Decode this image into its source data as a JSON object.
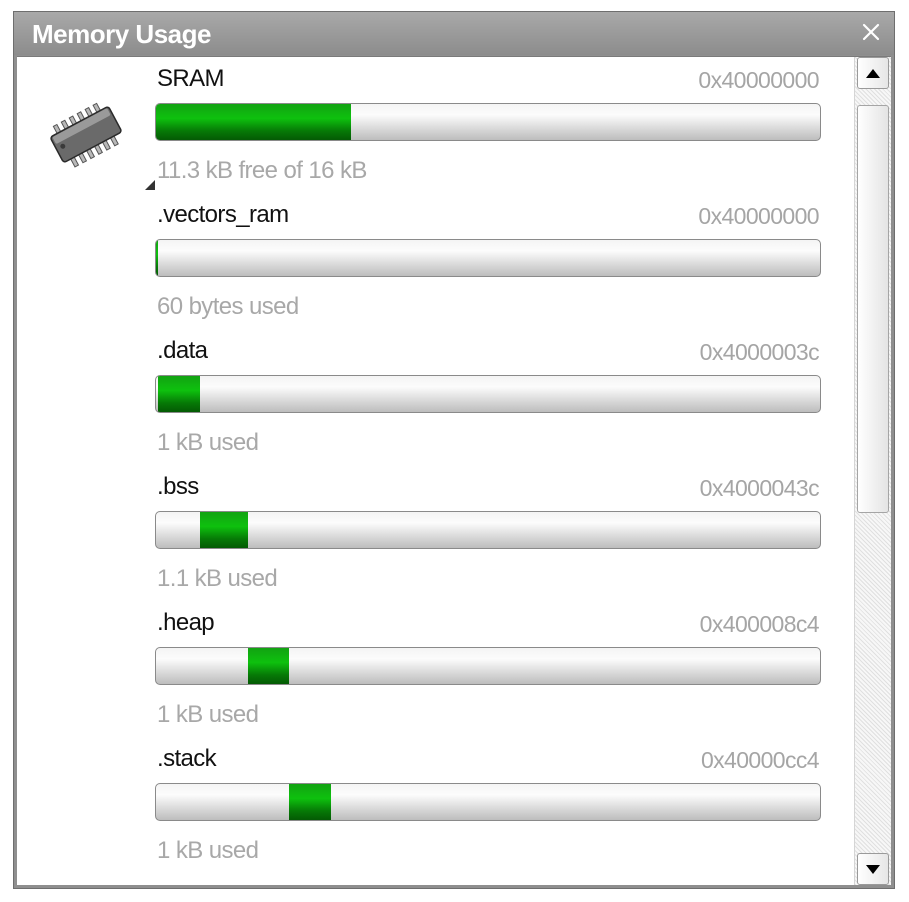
{
  "window": {
    "title": "Memory Usage",
    "close_label": "✕"
  },
  "memory": {
    "name": "SRAM",
    "address": "0x40000000",
    "summary": "11.3 kB free of 16 kB",
    "used_fraction": 0.294
  },
  "sections": [
    {
      "name": ".vectors_ram",
      "address": "0x40000000",
      "desc": "60 bytes used",
      "start_fraction": 0.0,
      "end_fraction": 0.0037
    },
    {
      "name": ".data",
      "address": "0x4000003c",
      "desc": "1 kB used",
      "start_fraction": 0.0037,
      "end_fraction": 0.066
    },
    {
      "name": ".bss",
      "address": "0x4000043c",
      "desc": "1.1 kB used",
      "start_fraction": 0.066,
      "end_fraction": 0.138
    },
    {
      "name": ".heap",
      "address": "0x400008c4",
      "desc": "1 kB used",
      "start_fraction": 0.138,
      "end_fraction": 0.2
    },
    {
      "name": ".stack",
      "address": "0x40000cc4",
      "desc": "1 kB used",
      "start_fraction": 0.2,
      "end_fraction": 0.263
    }
  ],
  "colors": {
    "fill_green": "#0ec10e",
    "title_bar": "#9a9a9a",
    "muted_text": "#a8a8a8"
  }
}
